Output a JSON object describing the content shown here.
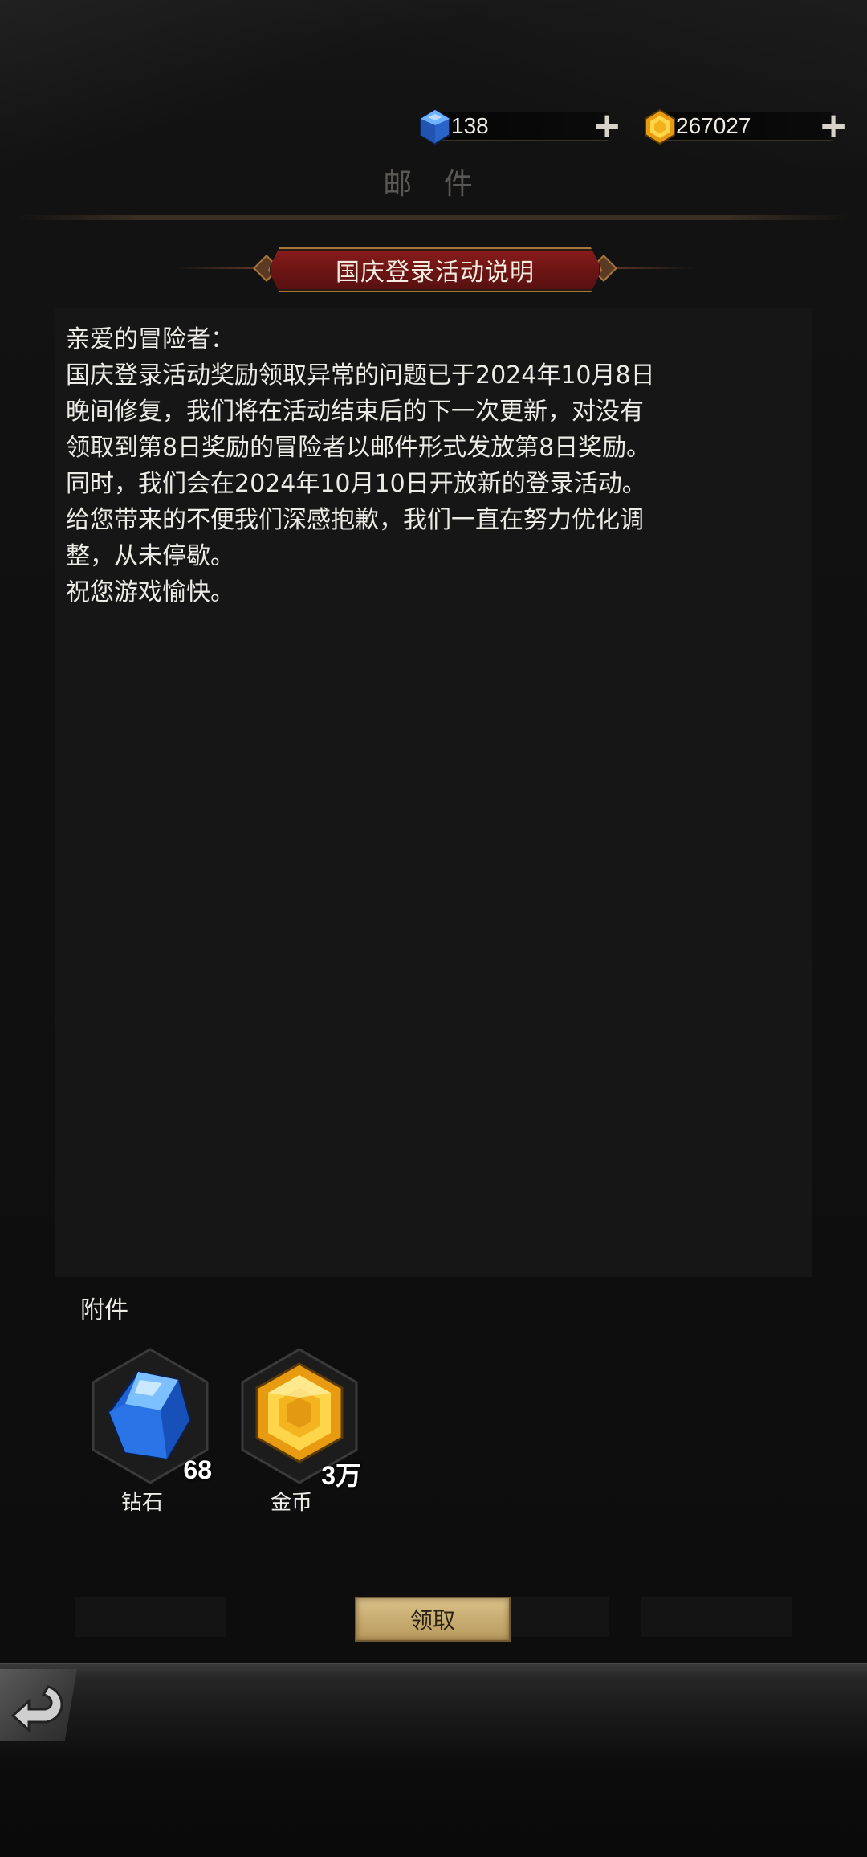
{
  "currency": {
    "diamond": {
      "value": "138",
      "icon": "blue-gem-icon",
      "color": "#3a7be0"
    },
    "gold": {
      "value": "267027",
      "icon": "gold-gem-icon",
      "color": "#f0b323"
    }
  },
  "header": {
    "title": "邮 件"
  },
  "mail": {
    "title": "国庆登录活动说明",
    "body": "亲爱的冒险者：\n国庆登录活动奖励领取异常的问题已于2024年10月8日\n晚间修复，我们将在活动结束后的下一次更新，对没有\n领取到第8日奖励的冒险者以邮件形式发放第8日奖励。\n同时，我们会在2024年10月10日开放新的登录活动。\n给您带来的不便我们深感抱歉，我们一直在努力优化调\n整，从未停歇。\n祝您游戏愉快。"
  },
  "attachments": {
    "label": "附件",
    "items": [
      {
        "name": "钻石",
        "count": "68",
        "icon": "blue-diamond-icon"
      },
      {
        "name": "金币",
        "count": "3万",
        "icon": "gold-coin-icon"
      }
    ]
  },
  "actions": {
    "claim_label": "领取"
  }
}
